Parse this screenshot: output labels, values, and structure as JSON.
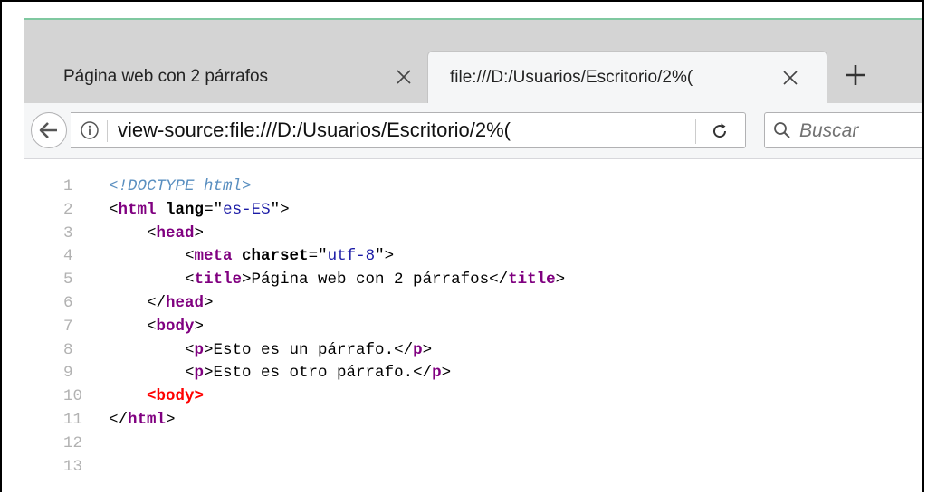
{
  "tabs": [
    {
      "label": "Página web con 2 párrafos",
      "active": false
    },
    {
      "label": "file:///D:/Usuarios/Escritorio/2%(",
      "active": true
    }
  ],
  "toolbar": {
    "url": "view-source:file:///D:/Usuarios/Escritorio/2%(",
    "search_placeholder": "Buscar"
  },
  "source": {
    "lines": [
      {
        "num": "1",
        "parts": [
          {
            "kind": "doctype",
            "text": "<!DOCTYPE html>"
          }
        ]
      },
      {
        "num": "2",
        "parts": [
          {
            "kind": "txt",
            "text": "<"
          },
          {
            "kind": "tag",
            "text": "html"
          },
          {
            "kind": "txt",
            "text": " "
          },
          {
            "kind": "attr",
            "text": "lang"
          },
          {
            "kind": "txt",
            "text": "=\""
          },
          {
            "kind": "val",
            "text": "es-ES"
          },
          {
            "kind": "txt",
            "text": "\">"
          }
        ]
      },
      {
        "num": "3",
        "parts": [
          {
            "kind": "txt",
            "text": "    <"
          },
          {
            "kind": "tag",
            "text": "head"
          },
          {
            "kind": "txt",
            "text": ">"
          }
        ]
      },
      {
        "num": "4",
        "parts": [
          {
            "kind": "txt",
            "text": "        <"
          },
          {
            "kind": "tag",
            "text": "meta"
          },
          {
            "kind": "txt",
            "text": " "
          },
          {
            "kind": "attr",
            "text": "charset"
          },
          {
            "kind": "txt",
            "text": "=\""
          },
          {
            "kind": "val",
            "text": "utf-8"
          },
          {
            "kind": "txt",
            "text": "\">"
          }
        ]
      },
      {
        "num": "5",
        "parts": [
          {
            "kind": "txt",
            "text": "        <"
          },
          {
            "kind": "tag",
            "text": "title"
          },
          {
            "kind": "txt",
            "text": ">Página web con 2 párrafos</"
          },
          {
            "kind": "tag",
            "text": "title"
          },
          {
            "kind": "txt",
            "text": ">"
          }
        ]
      },
      {
        "num": "6",
        "parts": [
          {
            "kind": "txt",
            "text": "    </"
          },
          {
            "kind": "tag",
            "text": "head"
          },
          {
            "kind": "txt",
            "text": ">"
          }
        ]
      },
      {
        "num": "7",
        "parts": [
          {
            "kind": "txt",
            "text": "    <"
          },
          {
            "kind": "tag",
            "text": "body"
          },
          {
            "kind": "txt",
            "text": ">"
          }
        ]
      },
      {
        "num": "8",
        "parts": [
          {
            "kind": "txt",
            "text": "        <"
          },
          {
            "kind": "tag",
            "text": "p"
          },
          {
            "kind": "txt",
            "text": ">Esto es un párrafo.</"
          },
          {
            "kind": "tag",
            "text": "p"
          },
          {
            "kind": "txt",
            "text": ">"
          }
        ]
      },
      {
        "num": "9",
        "parts": [
          {
            "kind": "txt",
            "text": "        <"
          },
          {
            "kind": "tag",
            "text": "p"
          },
          {
            "kind": "txt",
            "text": ">Esto es otro párrafo.</"
          },
          {
            "kind": "tag",
            "text": "p"
          },
          {
            "kind": "txt",
            "text": ">"
          }
        ]
      },
      {
        "num": "10",
        "parts": [
          {
            "kind": "txt",
            "text": "    "
          },
          {
            "kind": "tag-err",
            "text": "<body>"
          }
        ]
      },
      {
        "num": "11",
        "parts": [
          {
            "kind": "txt",
            "text": "</"
          },
          {
            "kind": "tag",
            "text": "html"
          },
          {
            "kind": "txt",
            "text": ">"
          }
        ]
      },
      {
        "num": "12",
        "parts": []
      },
      {
        "num": "13",
        "parts": []
      }
    ]
  },
  "colors": {
    "tag": "#800080",
    "error_tag": "#ff0000",
    "attr_value": "#1a1aa6",
    "doctype": "#5a8fc0",
    "line_number": "#b2b2b2"
  }
}
